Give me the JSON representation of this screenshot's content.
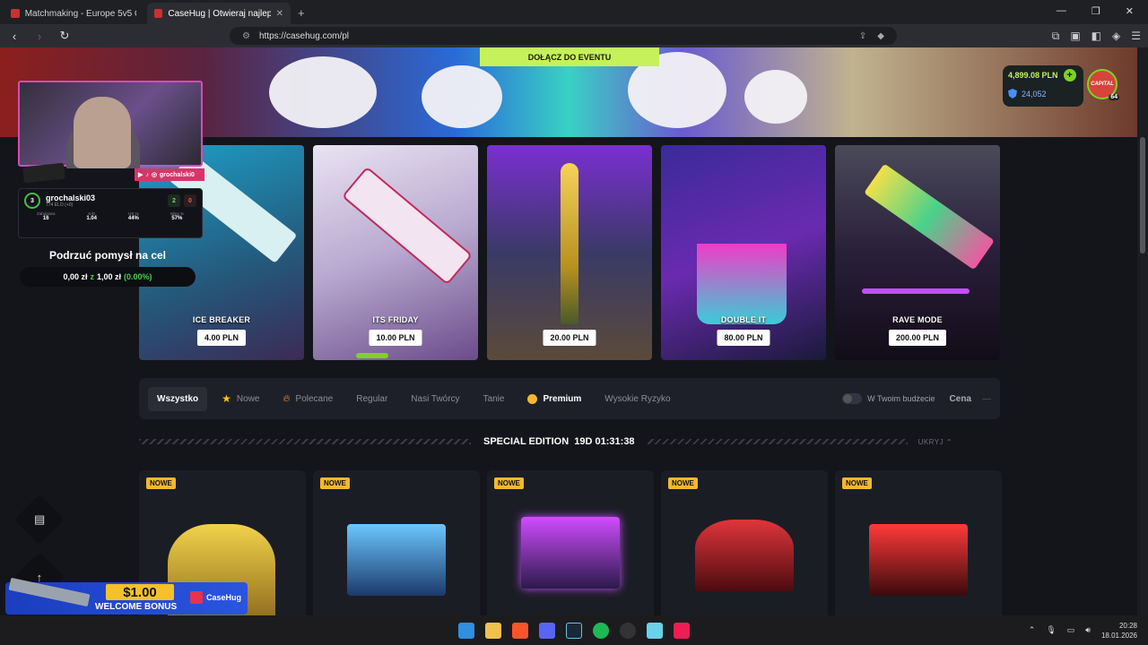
{
  "browser": {
    "tabs": [
      {
        "title": "Matchmaking - Europe 5v5 Queue - ",
        "active": false
      },
      {
        "title": "CaseHug | Otwieraj najlepsze sk",
        "active": true
      }
    ],
    "url": "https://casehug.com/pl"
  },
  "hero": {
    "event_button": "DOŁĄCZ DO EVENTU",
    "balance": "4,899.08 PLN",
    "coins": "24,052",
    "avatar_text": "CAPITAL",
    "level": "64"
  },
  "cases": [
    {
      "name": "ICE BREAKER",
      "price": "4.00 PLN",
      "bg": "#2a6b8a"
    },
    {
      "name": "ITS FRIDAY",
      "price": "10.00 PLN",
      "bg": "#b8a8cf"
    },
    {
      "name": "",
      "price": "20.00 PLN",
      "bg": "#3a3a66"
    },
    {
      "name": "DOUBLE IT",
      "price": "80.00 PLN",
      "bg": "#4a2a8a"
    },
    {
      "name": "RAVE MODE",
      "price": "200.00 PLN",
      "bg": "#3b2450"
    }
  ],
  "filters": {
    "items": [
      "Wszystko",
      "Nowe",
      "Polecane",
      "Regular",
      "Nasi Twórcy",
      "Tanie",
      "Premium",
      "Wysokie Ryzyko"
    ],
    "budget_label": "W Twoim budżecie",
    "sort_label": "Cena"
  },
  "section": {
    "title": "SPECIAL EDITION",
    "timer": "19D 01:31:38",
    "hide_label": "UKRYJ"
  },
  "cards": [
    {
      "badge": "NOWE",
      "color": "#c9a020"
    },
    {
      "badge": "NOWE",
      "color": "#2f7fd8"
    },
    {
      "badge": "NOWE",
      "color": "#8a3fd1"
    },
    {
      "badge": "NOWE",
      "color": "#b3151f"
    },
    {
      "badge": "NOWE",
      "color": "#c21a22"
    }
  ],
  "overlay": {
    "social": "grochalski0",
    "player": "grochalski03",
    "elo": "774 ELO (+0)",
    "level": "3",
    "wins": "2",
    "losses": "0",
    "stats": [
      {
        "k": "Zabójstwa",
        "v": "16"
      },
      {
        "k": "K/D",
        "v": "1.04"
      },
      {
        "k": "HS %",
        "v": "44%"
      },
      {
        "k": "Wins %",
        "v": "57%"
      }
    ],
    "goal_title": "Podrzuć pomysł na cel",
    "goal_current": "0,00 zł",
    "goal_sep": "z",
    "goal_target": "1,00 zł",
    "goal_pct": "(0.00%)"
  },
  "promo": {
    "amount": "$1.00",
    "text": "WELCOME BONUS",
    "brand": "CaseHug"
  },
  "taskbar": {
    "time": "20:28",
    "date": "18.01.2026"
  }
}
